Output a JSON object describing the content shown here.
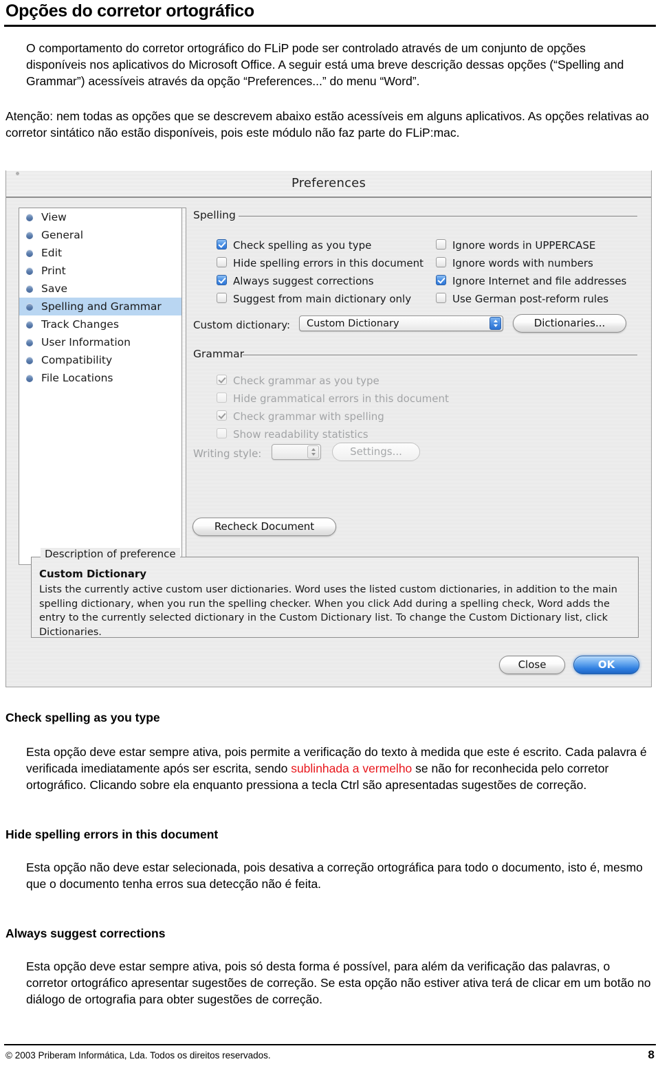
{
  "document": {
    "title": "Opções do corretor ortográfico",
    "intro_paragraph_1": "O comportamento do corretor ortográfico do FLiP pode ser controlado através de um conjunto de opções disponíveis nos aplicativos do Microsoft Office. A seguir está uma breve descrição dessas opções (“Spelling and Grammar”) acessíveis através da opção “Preferences...” do menu “Word”.",
    "intro_paragraph_2": "Atenção: nem todas as opções que se descrevem abaixo estão acessíveis em alguns aplicativos. As opções relativas ao corretor sintático não estão disponíveis, pois este módulo não faz parte do FLiP:mac.",
    "footer": {
      "copyright": "© 2003 Priberam Informática, Lda. Todos os direitos reservados.",
      "page_number": "8"
    }
  },
  "sections": [
    {
      "heading": "Check spelling as you type",
      "body_before_red": "Esta opção deve estar sempre ativa, pois permite a verificação do texto à medida que este é escrito. Cada palavra é verificada imediatamente após ser escrita, sendo ",
      "body_red": "sublinhada a vermelho",
      "body_after_red": " se não for reconhecida pelo corretor ortográfico. Clicando sobre ela enquanto pressiona a tecla Ctrl são apresentadas sugestões de correção."
    },
    {
      "heading": "Hide spelling errors in this document",
      "body": "Esta opção não deve estar selecionada, pois desativa a correção ortográfica para todo o documento, isto é, mesmo que o documento tenha erros sua detecção não é feita."
    },
    {
      "heading": "Always suggest corrections",
      "body": "Esta opção deve estar sempre ativa, pois só desta forma é possível, para além da verificação das palavras, o corretor ortográfico apresentar sugestões de correção. Se esta opção não estiver ativa terá de clicar em um botão no diálogo de ortografia para obter sugestões de correção."
    }
  ],
  "dialog": {
    "title": "Preferences",
    "sidebar": {
      "items": [
        {
          "label": "View",
          "selected": false
        },
        {
          "label": "General",
          "selected": false
        },
        {
          "label": "Edit",
          "selected": false
        },
        {
          "label": "Print",
          "selected": false
        },
        {
          "label": "Save",
          "selected": false
        },
        {
          "label": "Spelling and Grammar",
          "selected": true
        },
        {
          "label": "Track Changes",
          "selected": false
        },
        {
          "label": "User Information",
          "selected": false
        },
        {
          "label": "Compatibility",
          "selected": false
        },
        {
          "label": "File Locations",
          "selected": false
        }
      ]
    },
    "spelling": {
      "group_label": "Spelling",
      "checkboxes_left": [
        {
          "label": "Check spelling as you type",
          "checked": true,
          "enabled": true
        },
        {
          "label": "Hide spelling errors in this document",
          "checked": false,
          "enabled": true
        },
        {
          "label": "Always suggest corrections",
          "checked": true,
          "enabled": true
        },
        {
          "label": "Suggest from main dictionary only",
          "checked": false,
          "enabled": true
        }
      ],
      "checkboxes_right": [
        {
          "label": "Ignore words in UPPERCASE",
          "checked": false,
          "enabled": true
        },
        {
          "label": "Ignore words with numbers",
          "checked": false,
          "enabled": true
        },
        {
          "label": "Ignore Internet and file addresses",
          "checked": true,
          "enabled": true
        },
        {
          "label": "Use German post-reform rules",
          "checked": false,
          "enabled": true
        }
      ],
      "custom_dictionary_label": "Custom dictionary:",
      "custom_dictionary_value": "Custom Dictionary",
      "dictionaries_button": "Dictionaries..."
    },
    "grammar": {
      "group_label": "Grammar",
      "checkboxes": [
        {
          "label": "Check grammar as you type",
          "checked": true,
          "enabled": false
        },
        {
          "label": "Hide grammatical errors in this document",
          "checked": false,
          "enabled": false
        },
        {
          "label": "Check grammar with spelling",
          "checked": true,
          "enabled": false
        },
        {
          "label": "Show readability statistics",
          "checked": false,
          "enabled": false
        }
      ],
      "writing_style_label": "Writing style:",
      "writing_style_value": "",
      "settings_button": "Settings..."
    },
    "recheck_button": "Recheck Document",
    "description": {
      "group_label": "Description of preference",
      "heading": "Custom Dictionary",
      "text": "Lists the currently active custom user dictionaries. Word uses the listed custom dictionaries, in addition to the main spelling dictionary, when you run the spelling checker. When you click Add during a spelling check, Word adds the entry to the currently selected dictionary in the Custom Dictionary list. To change the Custom Dictionary list, click Dictionaries."
    },
    "close_button": "Close",
    "ok_button": "OK"
  },
  "colors": {
    "accent_blue": "#2f76d6",
    "selection_blue": "#b9d6f2",
    "red_text": "#e8171c"
  }
}
